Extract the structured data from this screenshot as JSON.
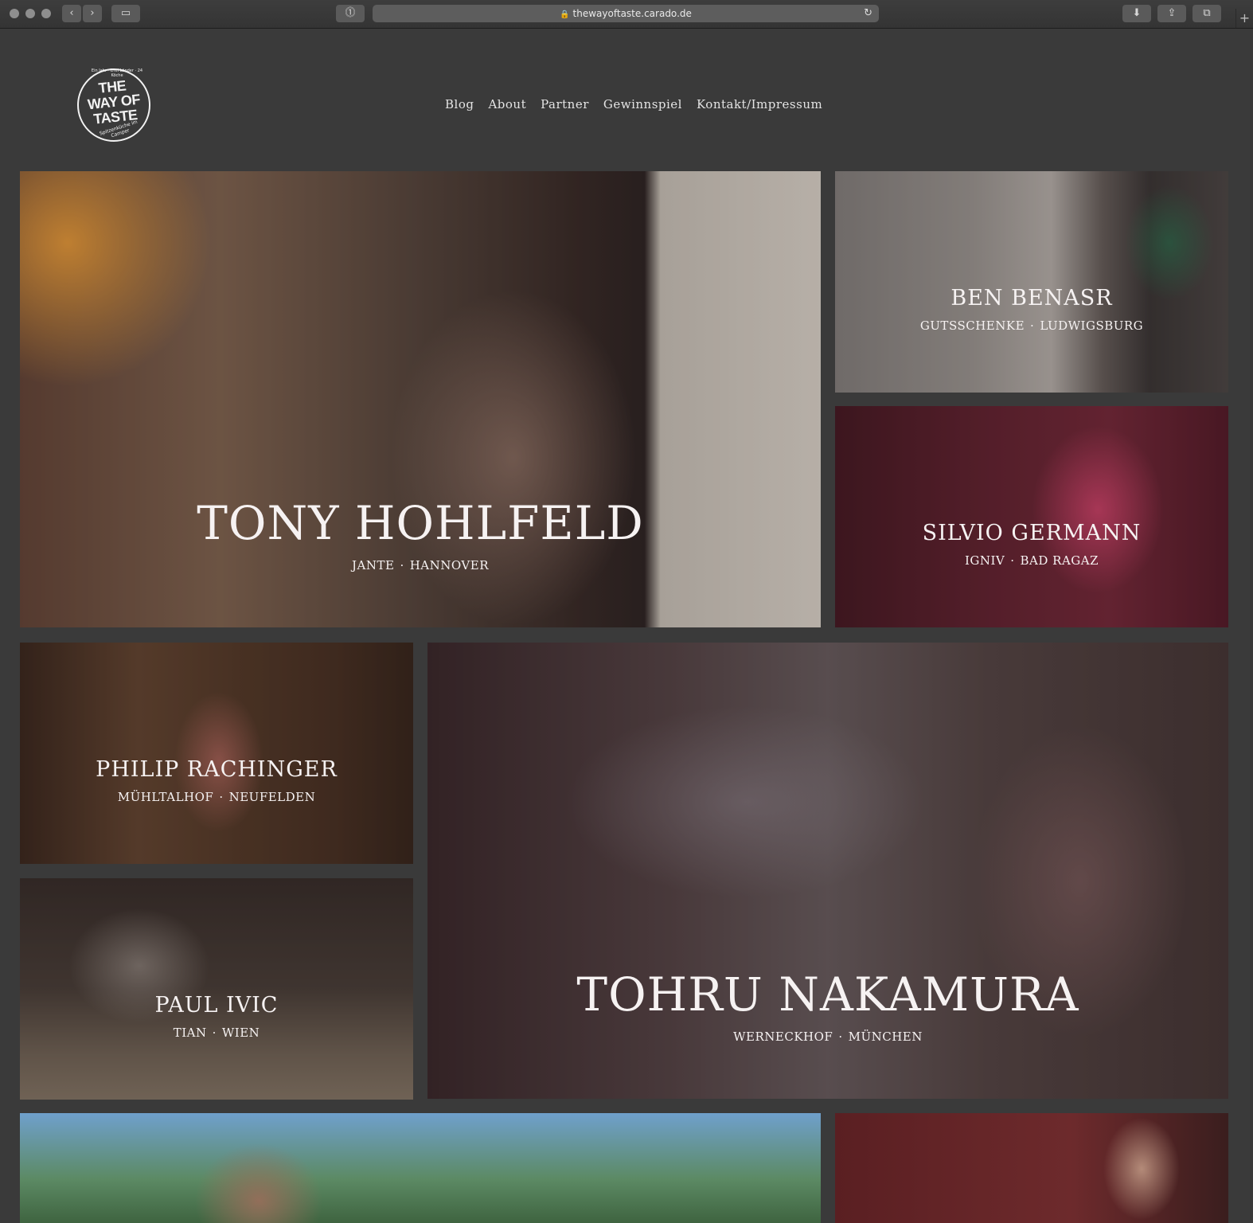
{
  "browser": {
    "url": "thewayoftaste.carado.de"
  },
  "logo": {
    "line1": "THE",
    "line2": "WAY OF",
    "line3": "TASTE",
    "arc_top": "Ein Jahr · Drei Länder · 24 Köche",
    "arc_bottom": "Spitzenküche im Camper"
  },
  "nav": {
    "items": [
      "Blog",
      "About",
      "Partner",
      "Gewinnspiel",
      "Kontakt/Impressum"
    ]
  },
  "chefs": [
    {
      "name": "TONY HOHLFELD",
      "restaurant": "JANTE",
      "city": "HANNOVER"
    },
    {
      "name": "BEN BENASR",
      "restaurant": "GUTSSCHENKE",
      "city": "LUDWIGSBURG"
    },
    {
      "name": "SILVIO GERMANN",
      "restaurant": "IGNIV",
      "city": "BAD RAGAZ"
    },
    {
      "name": "PHILIP RACHINGER",
      "restaurant": "MÜHLTALHOF",
      "city": "NEUFELDEN"
    },
    {
      "name": "PAUL IVIC",
      "restaurant": "TIAN",
      "city": "WIEN"
    },
    {
      "name": "TOHRU NAKAMURA",
      "restaurant": "WERNECKHOF",
      "city": "MÜNCHEN"
    }
  ],
  "separator": "·"
}
